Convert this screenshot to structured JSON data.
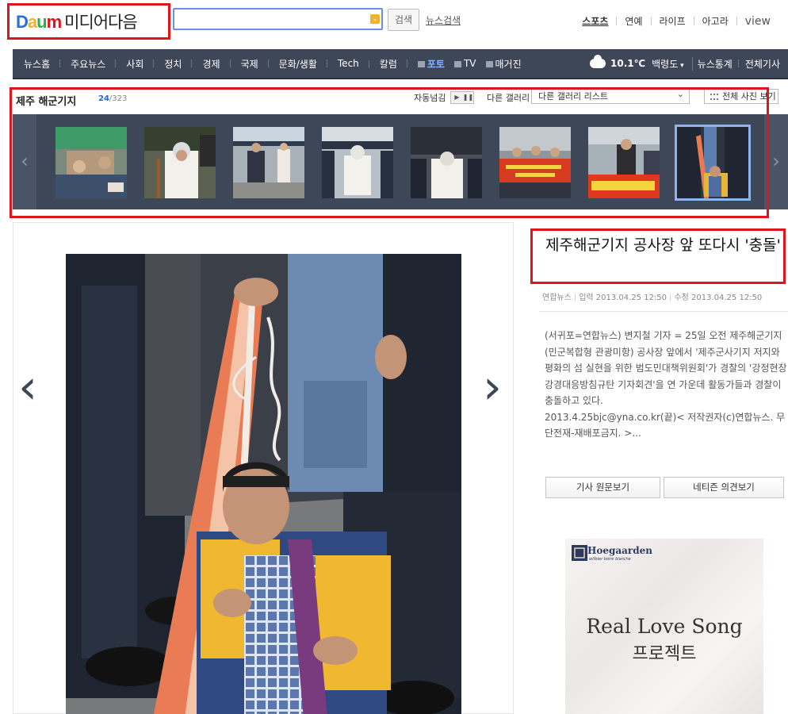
{
  "header": {
    "logo_brand": "Daum",
    "logo_sub": "미디어다음",
    "search_button": "검색",
    "news_search": "뉴스검색",
    "top_nav": [
      "스포츠",
      "연예",
      "라이프",
      "아고라",
      "view"
    ]
  },
  "nav": {
    "items": [
      "뉴스홈",
      "주요뉴스",
      "사회",
      "정치",
      "경제",
      "국제",
      "문화/생활",
      "Tech",
      "칼럼"
    ],
    "media": [
      "포토",
      "TV",
      "매거진"
    ],
    "active": "포토",
    "temperature": "10.1℃",
    "location": "백령도",
    "right_links": [
      "뉴스통계",
      "전체기사"
    ]
  },
  "gallery": {
    "title": "제주 해군기지",
    "current": "24",
    "total": "/323",
    "autoplay_label": "자동넘김",
    "other_gallery_label": "다른 갤러리",
    "select_value": "다른 갤러리 리스트",
    "all_photos": "전체 사진 보기",
    "thumbnail_count": 9,
    "selected_index": 8
  },
  "article": {
    "title": "제주해군기지 공사장 앞 또다시 '충돌'",
    "source": "연합뉴스",
    "input_label": "입력",
    "input_time": "2013.04.25 12:50",
    "edit_label": "수정",
    "edit_time": "2013.04.25 12:50",
    "body": "(서귀포=연합뉴스) 변지철 기자 = 25일 오전 제주해군기지(민군복합형 관광미항) 공사장 앞에서 '제주군사기지 저지와 평화의 섬 실현을 위한 범도민대책위원회'가 경찰의 '강정현장 강경대응방침규탄 기자회견'을 연 가운데 활동가들과 경찰이 충돌하고 있다.",
    "body2": "2013.4.25bjc@yna.co.kr(끝)< 저작권자(c)연합뉴스. 무단전재-재배포금지. >...",
    "button_original": "기사 원문보기",
    "button_comments": "네티즌 의견보기"
  },
  "ad": {
    "brand": "Hoegaarden",
    "tagline": "witbier·bière blanche",
    "line1": "Real Love Song",
    "line2": "프로젝트"
  },
  "colors": {
    "nav_bg": "#3d4757",
    "highlight": "#e0141b",
    "active_link": "#8ab6ff"
  }
}
